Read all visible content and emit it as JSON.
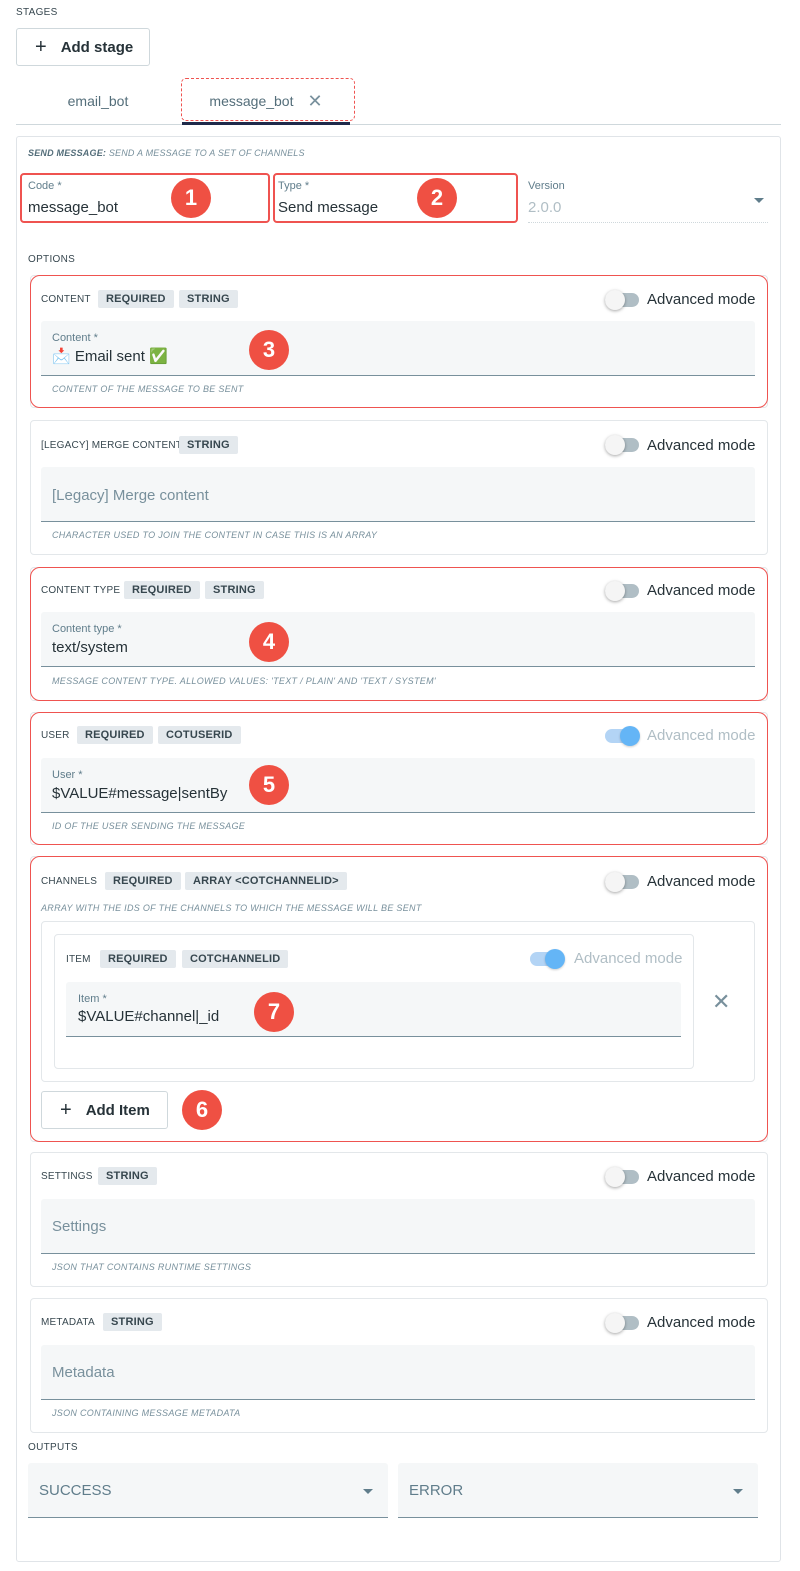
{
  "stages": {
    "label": "STAGES",
    "add_stage": "Add stage",
    "add_icon": "plus-icon",
    "tabs": [
      {
        "label": "email_bot"
      },
      {
        "label": "message_bot",
        "close_icon": "close-icon"
      }
    ]
  },
  "header": {
    "title": "SEND MESSAGE:",
    "description": "SEND A MESSAGE TO A SET OF CHANNELS"
  },
  "fields": {
    "code": {
      "label": "Code *",
      "value": "message_bot"
    },
    "type": {
      "label": "Type *",
      "value": "Send message"
    },
    "version": {
      "label": "Version",
      "value": "2.0.0"
    }
  },
  "options_label": "OPTIONS",
  "advanced_mode_label": "Advanced mode",
  "options": {
    "content": {
      "title": "CONTENT",
      "chips": [
        "REQUIRED",
        "STRING"
      ],
      "field_label": "Content *",
      "value": "📩 Email sent ✅",
      "helper": "CONTENT OF THE MESSAGE TO BE SENT",
      "advanced": false
    },
    "merge": {
      "title": "[LEGACY] MERGE CONTENT",
      "chips": [
        "STRING"
      ],
      "placeholder": "[Legacy] Merge content",
      "helper": "CHARACTER USED TO JOIN THE CONTENT IN CASE THIS IS AN ARRAY",
      "advanced": false
    },
    "content_type": {
      "title": "CONTENT TYPE",
      "chips": [
        "REQUIRED",
        "STRING"
      ],
      "field_label": "Content type *",
      "value": "text/system",
      "helper": "MESSAGE CONTENT TYPE. ALLOWED VALUES: 'TEXT / PLAIN' AND 'TEXT / SYSTEM'",
      "advanced": false
    },
    "user": {
      "title": "USER",
      "chips": [
        "REQUIRED",
        "COTUSERID"
      ],
      "field_label": "User *",
      "value": "$VALUE#message|sentBy",
      "helper": "ID OF THE USER SENDING THE MESSAGE",
      "advanced": true
    },
    "channels": {
      "title": "CHANNELS",
      "chips": [
        "REQUIRED",
        "ARRAY <COTCHANNELID>"
      ],
      "helper": "ARRAY WITH THE IDS OF THE CHANNELS TO WHICH THE MESSAGE WILL BE SENT",
      "advanced": false,
      "item": {
        "title": "ITEM",
        "chips": [
          "REQUIRED",
          "COTCHANNELID"
        ],
        "field_label": "Item *",
        "value": "$VALUE#channel|_id",
        "advanced": true
      },
      "add_item": "Add Item"
    },
    "settings": {
      "title": "SETTINGS",
      "chips": [
        "STRING"
      ],
      "placeholder": "Settings",
      "helper": "JSON THAT CONTAINS RUNTIME SETTINGS",
      "advanced": false
    },
    "metadata": {
      "title": "METADATA",
      "chips": [
        "STRING"
      ],
      "placeholder": "Metadata",
      "helper": "JSON CONTAINING MESSAGE METADATA",
      "advanced": false
    }
  },
  "outputs": {
    "label": "OUTPUTS",
    "success": "SUCCESS",
    "error": "ERROR"
  },
  "annotations": [
    "1",
    "2",
    "3",
    "4",
    "5",
    "6",
    "7"
  ],
  "colors": {
    "annotation": "#ef5350",
    "badge": "#ef5043",
    "tab_underline": "#1e2a4a",
    "toggle_on": "#64b5f6",
    "toggle_off": "#b0bec5"
  }
}
